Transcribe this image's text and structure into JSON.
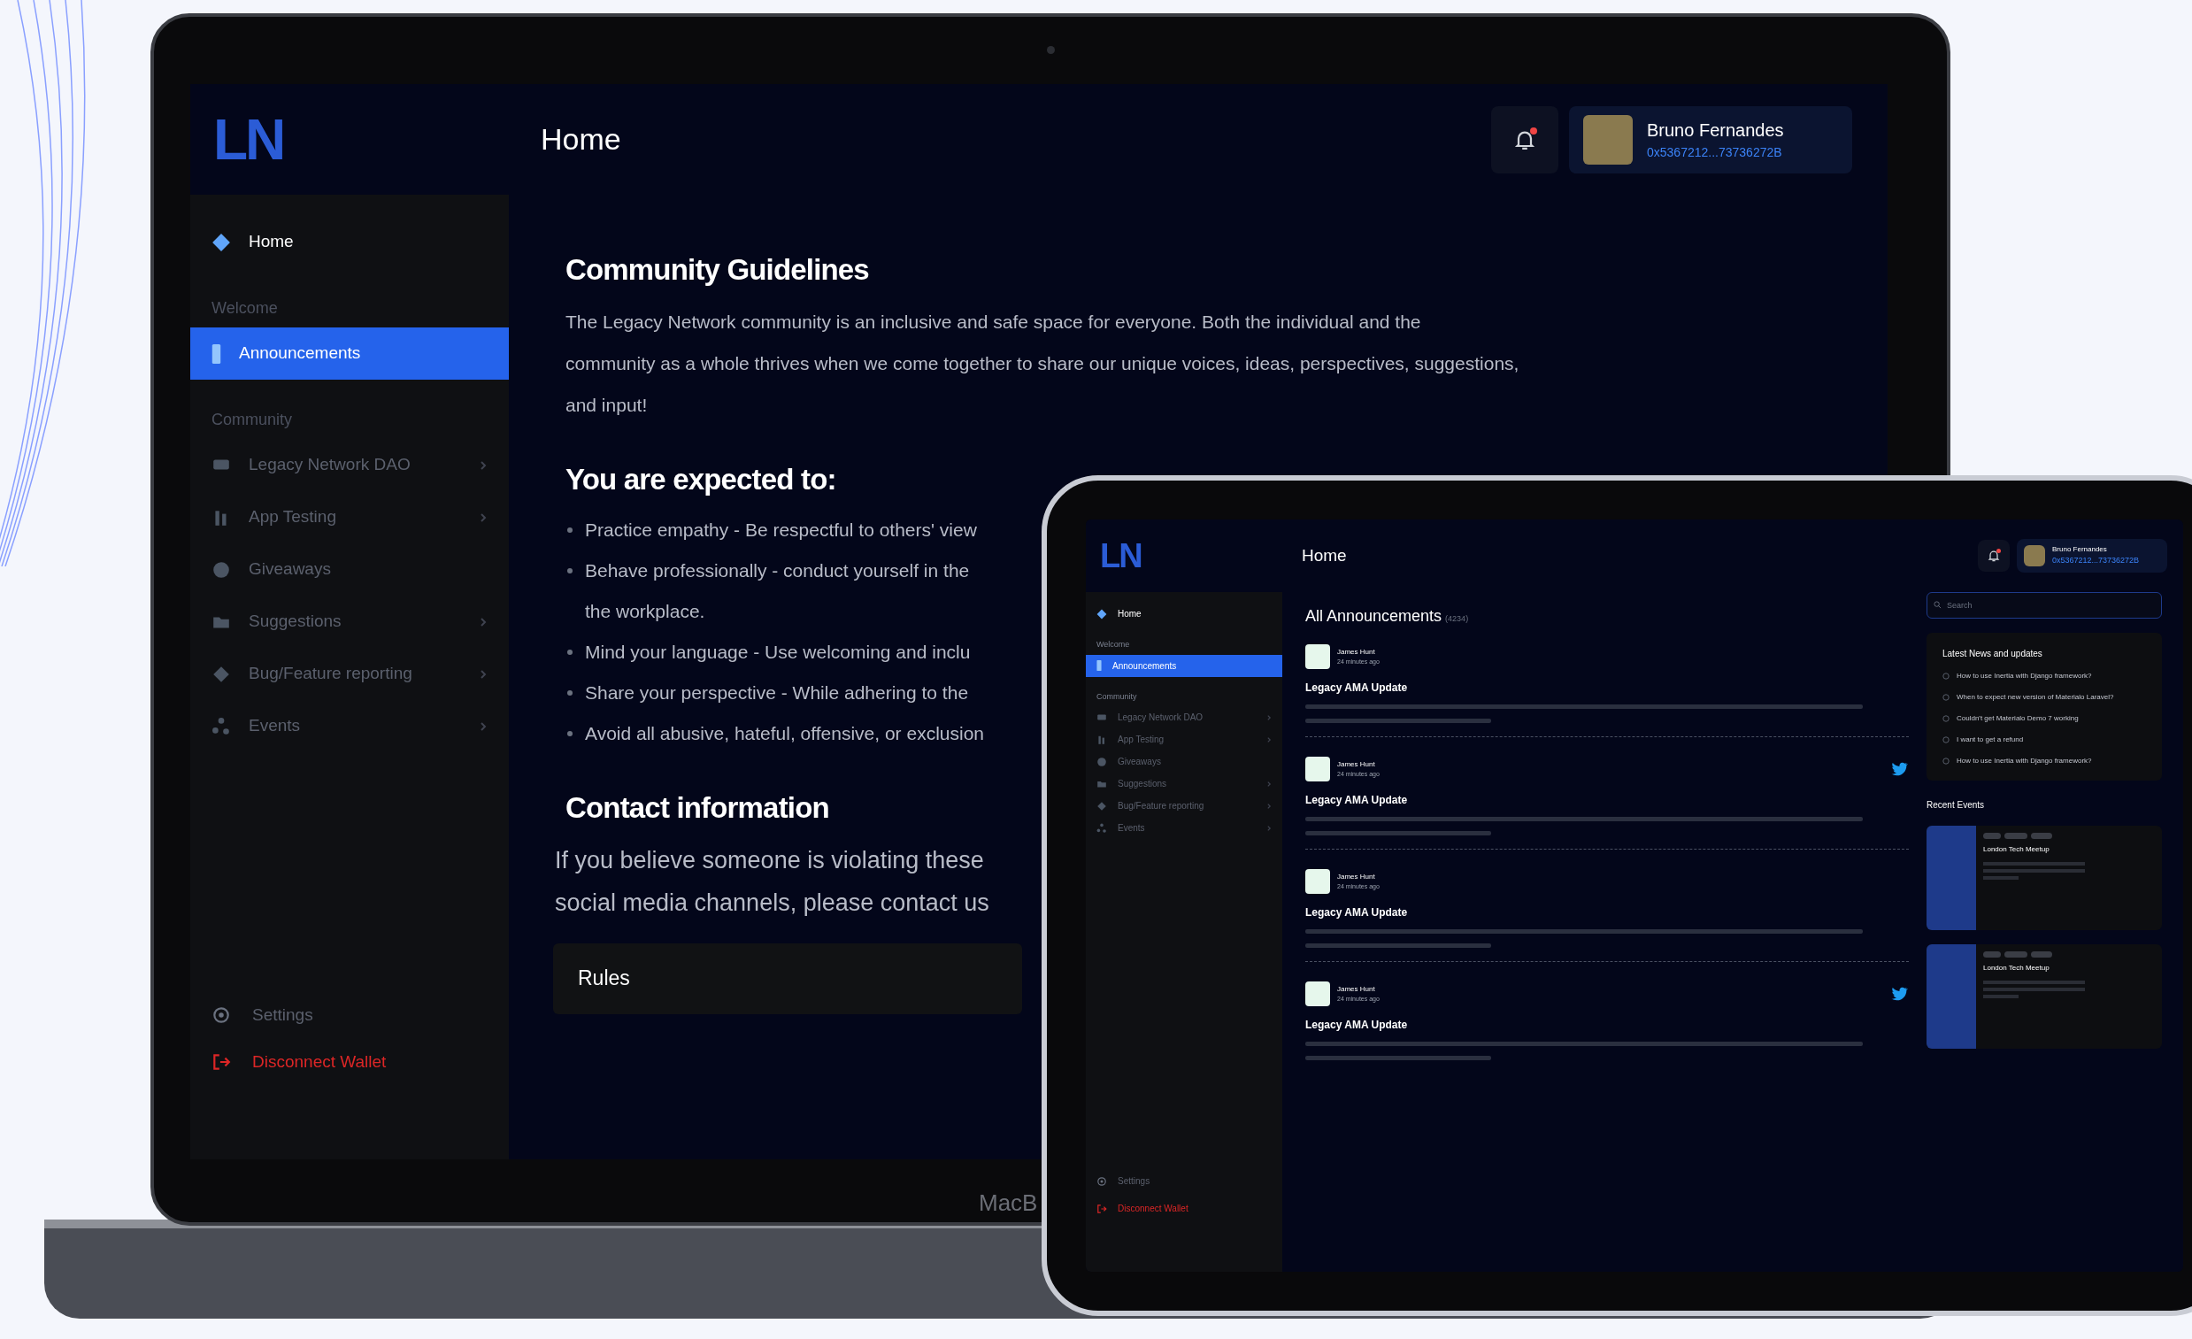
{
  "laptop": {
    "brand_label": "MacB",
    "logo": "LN",
    "header_title": "Home",
    "notifications": {
      "unread": true
    },
    "user": {
      "name": "Bruno Fernandes",
      "address": "0x5367212...73736272B"
    },
    "sidebar": {
      "items": [
        {
          "kind": "link",
          "label": "Home",
          "selected": false,
          "expandable": false
        },
        {
          "kind": "section",
          "label": "Welcome"
        },
        {
          "kind": "link",
          "label": "Announcements",
          "selected": true,
          "expandable": false
        },
        {
          "kind": "section",
          "label": "Community"
        },
        {
          "kind": "link",
          "label": "Legacy Network DAO",
          "selected": false,
          "expandable": true
        },
        {
          "kind": "link",
          "label": "App Testing",
          "selected": false,
          "expandable": true
        },
        {
          "kind": "link",
          "label": "Giveaways",
          "selected": false,
          "expandable": false
        },
        {
          "kind": "link",
          "label": "Suggestions",
          "selected": false,
          "expandable": true
        },
        {
          "kind": "link",
          "label": "Bug/Feature reporting",
          "selected": false,
          "expandable": true
        },
        {
          "kind": "link",
          "label": "Events",
          "selected": false,
          "expandable": true
        }
      ],
      "footer": [
        {
          "kind": "settings",
          "label": "Settings"
        },
        {
          "kind": "danger",
          "label": "Disconnect Wallet"
        }
      ]
    },
    "content": [
      {
        "kind": "heading",
        "text": "Community Guidelines"
      },
      {
        "kind": "paragraph",
        "lines": [
          "The Legacy Network community is an inclusive and safe space for everyone. Both the individual and the",
          "community as a whole thrives when we come together to share our unique voices, ideas, perspectives, suggestions,",
          "and input!"
        ]
      },
      {
        "kind": "heading",
        "text": "You are expected to:"
      },
      {
        "kind": "bullets",
        "items": [
          {
            "lines": [
              "Practice empathy - Be respectful to others' view"
            ]
          },
          {
            "lines": [
              "Behave professionally - conduct yourself in the",
              "the workplace."
            ]
          },
          {
            "lines": [
              "Mind your language - Use welcoming and inclu"
            ]
          },
          {
            "lines": [
              "Share your perspective - While adhering to the"
            ]
          },
          {
            "lines": [
              "Avoid all abusive, hateful, offensive, or exclusion"
            ]
          }
        ]
      },
      {
        "kind": "heading",
        "text": "Contact information"
      },
      {
        "kind": "lead",
        "lines": [
          "If you believe someone is violating these",
          "social media channels, please contact us"
        ]
      },
      {
        "kind": "button",
        "text": "Rules"
      }
    ]
  },
  "tablet": {
    "logo": "LN",
    "header_title": "Home",
    "notifications": {
      "unread": true
    },
    "user": {
      "name": "Bruno Fernandes",
      "address": "0x5367212...73736272B"
    },
    "sidebar": {
      "items": [
        {
          "kind": "link",
          "label": "Home",
          "selected": false,
          "expandable": false
        },
        {
          "kind": "section",
          "label": "Welcome"
        },
        {
          "kind": "link",
          "label": "Announcements",
          "selected": true,
          "expandable": false
        },
        {
          "kind": "section",
          "label": "Community"
        },
        {
          "kind": "link",
          "label": "Legacy Network DAO",
          "selected": false,
          "expandable": true
        },
        {
          "kind": "link",
          "label": "App Testing",
          "selected": false,
          "expandable": true
        },
        {
          "kind": "link",
          "label": "Giveaways",
          "selected": false,
          "expandable": false
        },
        {
          "kind": "link",
          "label": "Suggestions",
          "selected": false,
          "expandable": true
        },
        {
          "kind": "link",
          "label": "Bug/Feature reporting",
          "selected": false,
          "expandable": true
        },
        {
          "kind": "link",
          "label": "Events",
          "selected": false,
          "expandable": true
        }
      ],
      "footer": [
        {
          "kind": "settings",
          "label": "Settings"
        },
        {
          "kind": "danger",
          "label": "Disconnect Wallet"
        }
      ]
    },
    "announcements": {
      "title": "All Announcements",
      "count": "(4234)",
      "items": [
        {
          "author": "James Hunt",
          "time": "24 minutes ago",
          "title": "Legacy AMA Update",
          "twitter": false
        },
        {
          "author": "James Hunt",
          "time": "24 minutes ago",
          "title": "Legacy AMA Update",
          "twitter": true
        },
        {
          "author": "James Hunt",
          "time": "24 minutes ago",
          "title": "Legacy AMA Update",
          "twitter": false
        },
        {
          "author": "James Hunt",
          "time": "24 minutes ago",
          "title": "Legacy AMA Update",
          "twitter": true
        }
      ]
    },
    "search": {
      "placeholder": "Search"
    },
    "news": {
      "title": "Latest News and updates",
      "items": [
        "How to use Inertia with Django framework?",
        "When to expect new version of Materialo Laravel?",
        "Couldn't get Materialo Demo 7 working",
        "I want to get a refund",
        "How to use Inertia with Django framework?"
      ]
    },
    "events": {
      "title": "Recent Events",
      "items": [
        {
          "title": "London Tech Meetup"
        },
        {
          "title": "London Tech Meetup"
        }
      ]
    }
  }
}
